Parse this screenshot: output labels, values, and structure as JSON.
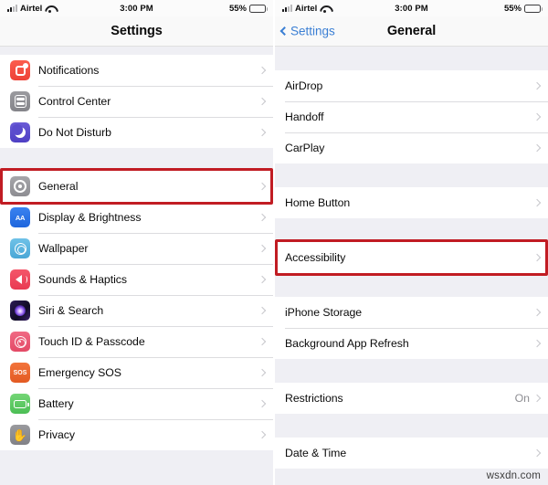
{
  "status_bar": {
    "carrier": "Airtel",
    "time": "3:00 PM",
    "battery_pct": "55%",
    "signal_icon": "signal-bars-icon",
    "wifi_icon": "wifi-icon",
    "battery_icon": "battery-icon"
  },
  "colors": {
    "highlight_red": "#c11c23",
    "accent_blue": "#3b7fd4",
    "list_bg": "#efeff4",
    "row_bg": "#ffffff",
    "chevron": "#c7c7cc",
    "value_gray": "#8e8e93"
  },
  "left_panel": {
    "title": "Settings",
    "groups": [
      {
        "rows": [
          {
            "label": "Notifications",
            "icon": "notifications-icon"
          },
          {
            "label": "Control Center",
            "icon": "control-center-icon"
          },
          {
            "label": "Do Not Disturb",
            "icon": "do-not-disturb-icon"
          }
        ]
      },
      {
        "rows": [
          {
            "label": "General",
            "icon": "general-gear-icon",
            "highlighted": true
          },
          {
            "label": "Display & Brightness",
            "icon": "display-brightness-icon"
          },
          {
            "label": "Wallpaper",
            "icon": "wallpaper-icon"
          },
          {
            "label": "Sounds & Haptics",
            "icon": "sounds-haptics-icon"
          },
          {
            "label": "Siri & Search",
            "icon": "siri-search-icon"
          },
          {
            "label": "Touch ID & Passcode",
            "icon": "touch-id-icon"
          },
          {
            "label": "Emergency SOS",
            "icon": "emergency-sos-icon"
          },
          {
            "label": "Battery",
            "icon": "battery-settings-icon"
          },
          {
            "label": "Privacy",
            "icon": "privacy-hand-icon"
          }
        ]
      }
    ]
  },
  "right_panel": {
    "title": "General",
    "back_label": "Settings",
    "back_icon": "chevron-left-icon",
    "groups": [
      {
        "rows": [
          {
            "label": "AirDrop"
          },
          {
            "label": "Handoff"
          },
          {
            "label": "CarPlay"
          }
        ]
      },
      {
        "rows": [
          {
            "label": "Home Button"
          }
        ]
      },
      {
        "rows": [
          {
            "label": "Accessibility",
            "highlighted": true
          }
        ]
      },
      {
        "rows": [
          {
            "label": "iPhone Storage"
          },
          {
            "label": "Background App Refresh"
          }
        ]
      },
      {
        "rows": [
          {
            "label": "Restrictions",
            "value": "On"
          }
        ]
      },
      {
        "rows": [
          {
            "label": "Date & Time"
          }
        ]
      }
    ]
  },
  "watermark": "wsxdn.com"
}
